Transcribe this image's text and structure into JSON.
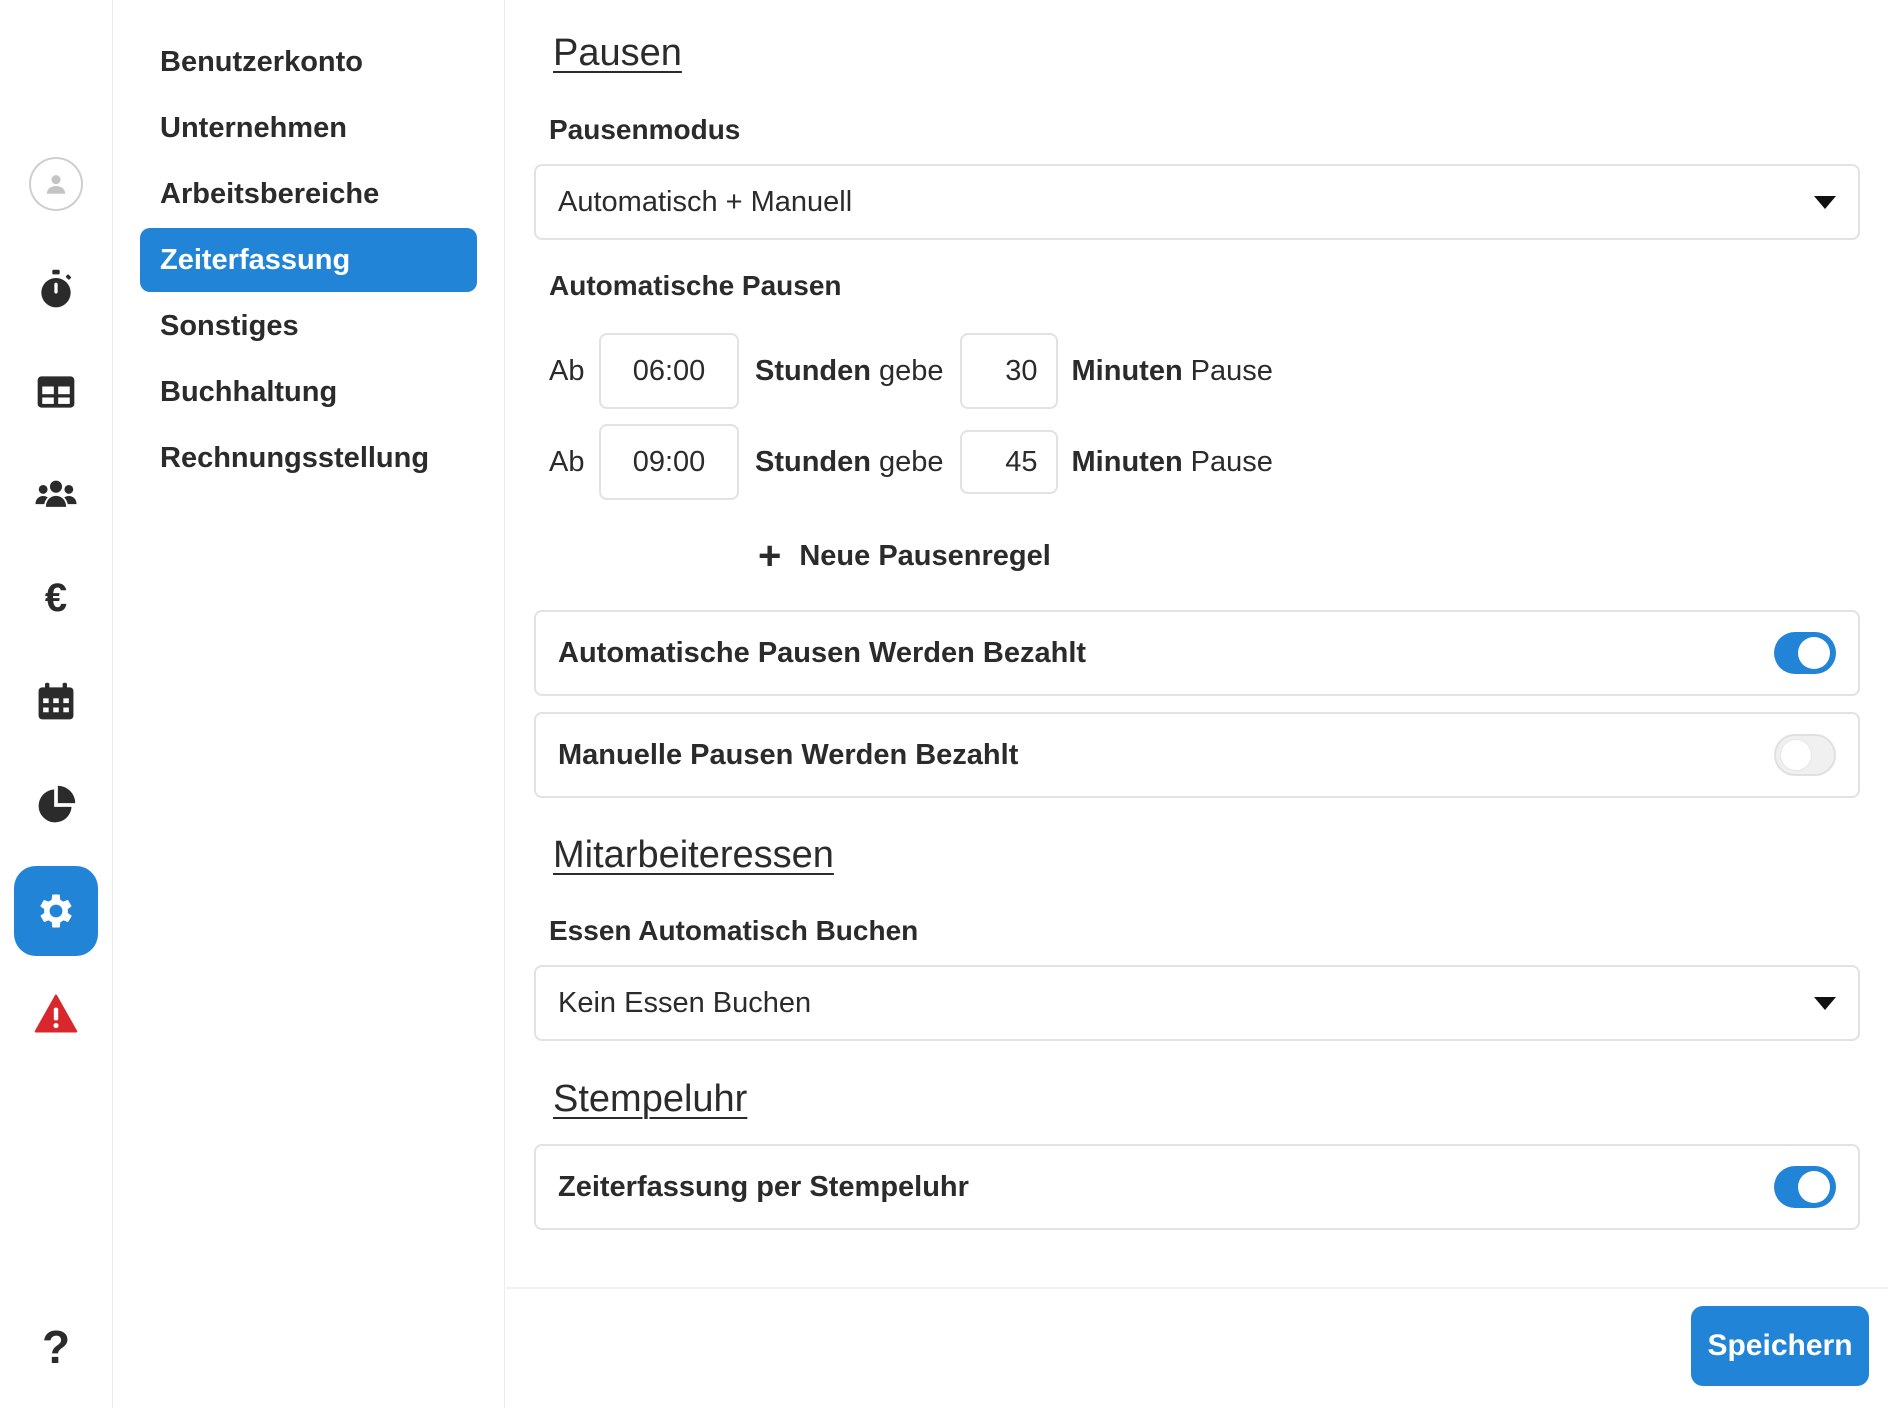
{
  "rail": {
    "items": [
      {
        "icon": "user-avatar-icon"
      },
      {
        "icon": "stopwatch-icon"
      },
      {
        "icon": "table-grid-icon"
      },
      {
        "icon": "users-group-icon"
      },
      {
        "icon": "euro-icon",
        "glyph": "€"
      },
      {
        "icon": "calendar-icon"
      },
      {
        "icon": "pie-chart-icon"
      },
      {
        "icon": "gear-icon",
        "active": true
      },
      {
        "icon": "warning-icon",
        "color": "#d9272e"
      },
      {
        "icon": "help-icon",
        "glyph": "?"
      }
    ]
  },
  "submenu": {
    "items": [
      {
        "label": "Benutzerkonto"
      },
      {
        "label": "Unternehmen"
      },
      {
        "label": "Arbeitsbereiche"
      },
      {
        "label": "Zeiterfassung",
        "active": true
      },
      {
        "label": "Sonstiges"
      },
      {
        "label": "Buchhaltung"
      },
      {
        "label": "Rechnungsstellung"
      }
    ]
  },
  "pausen": {
    "title": "Pausen",
    "mode_label": "Pausenmodus",
    "mode_value": "Automatisch + Manuell",
    "auto_label": "Automatische Pausen",
    "rules": [
      {
        "prefix": "Ab",
        "hours": "06:00",
        "hours_word": "Stunden",
        "give": "gebe",
        "minutes": "30",
        "minutes_word": "Minuten",
        "suffix": "Pause"
      },
      {
        "prefix": "Ab",
        "hours": "09:00",
        "hours_word": "Stunden",
        "give": "gebe",
        "minutes": "45",
        "minutes_word": "Minuten",
        "suffix": "Pause"
      }
    ],
    "add_rule": "Neue Pausenregel",
    "toggles": [
      {
        "label": "Automatische Pausen Werden Bezahlt",
        "on": true
      },
      {
        "label": "Manuelle Pausen Werden Bezahlt",
        "on": false
      }
    ]
  },
  "essen": {
    "title": "Mitarbeiteressen",
    "label": "Essen Automatisch Buchen",
    "value": "Kein Essen Buchen"
  },
  "stempeluhr": {
    "title": "Stempeluhr",
    "toggle": {
      "label": "Zeiterfassung per Stempeluhr",
      "on": true
    }
  },
  "footer": {
    "save_label": "Speichern"
  },
  "colors": {
    "accent": "#2284d6",
    "warning": "#d9272e"
  }
}
